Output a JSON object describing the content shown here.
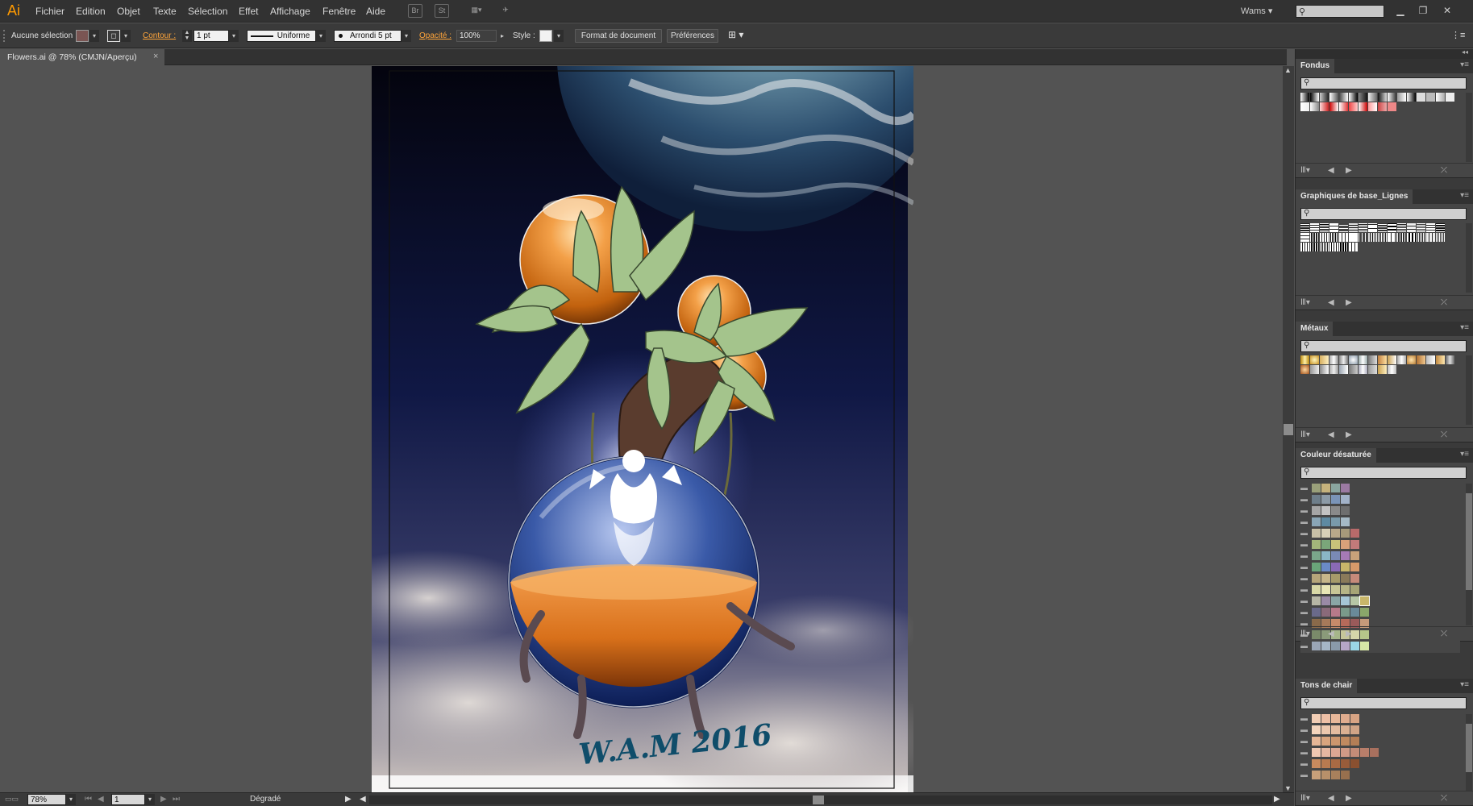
{
  "app": {
    "logo": "Ai",
    "workspace": "Wams"
  },
  "menu": [
    "Fichier",
    "Edition",
    "Objet",
    "Texte",
    "Sélection",
    "Effet",
    "Affichage",
    "Fenêtre",
    "Aide"
  ],
  "menu_icons": {
    "bridge": "Br",
    "stock": "St"
  },
  "control": {
    "selection": "Aucune sélection",
    "stroke_label": "Contour :",
    "stroke_weight": "1 pt",
    "profile": "Uniforme",
    "brush": "Arrondi 5 pt",
    "opacity_label": "Opacité :",
    "opacity": "100%",
    "style_label": "Style :",
    "doc_setup": "Format de document",
    "prefs": "Préférences",
    "fill_color": "#7a5553"
  },
  "document": {
    "tab": "Flowers.ai @ 78% (CMJN/Aperçu)",
    "close": "×"
  },
  "status": {
    "zoom": "78%",
    "artboard": "1",
    "tool": "Dégradé"
  },
  "artwork": {
    "signature": "W.A.M 2016"
  },
  "panels": [
    {
      "title": "Fondus"
    },
    {
      "title": "Graphiques de base_Lignes"
    },
    {
      "title": "Métaux"
    },
    {
      "title": "Couleur désaturée"
    },
    {
      "title": "Tons de chair"
    }
  ],
  "colors": {
    "accent": "#ff9a00",
    "chrome": "#323232",
    "canvas": "#535353"
  }
}
